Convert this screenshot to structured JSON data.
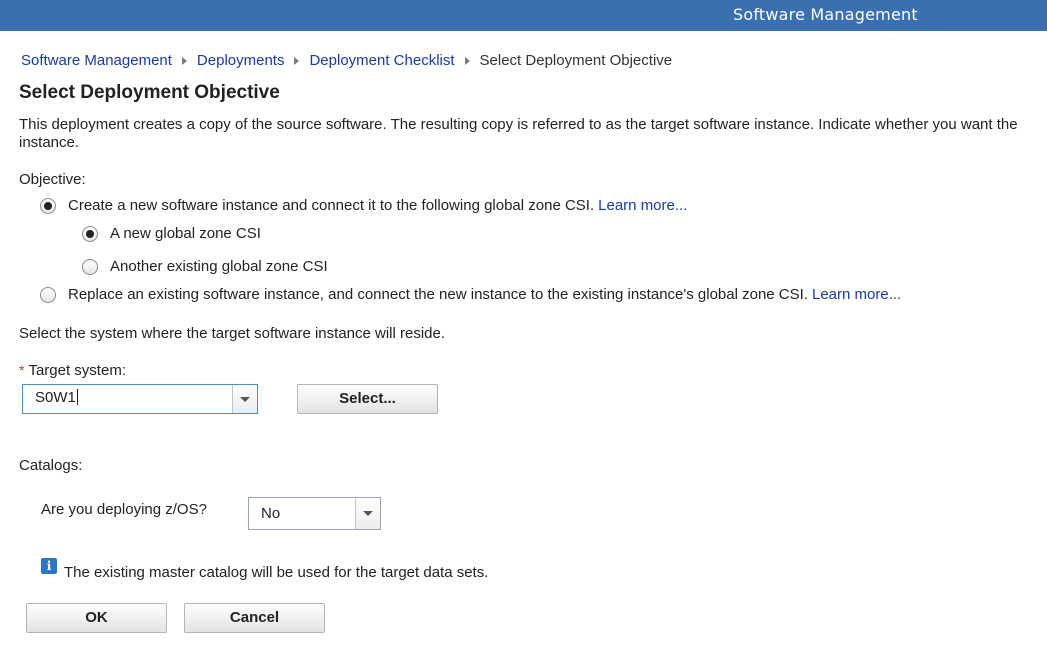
{
  "header": {
    "title": "Software Management"
  },
  "breadcrumb": {
    "items": [
      "Software Management",
      "Deployments",
      "Deployment Checklist"
    ],
    "current": "Select Deployment Objective"
  },
  "page": {
    "title": "Select Deployment Objective",
    "intro_line1": "This deployment creates a copy of the source software. The resulting copy is referred to as the target software instance. Indicate whether you want the",
    "intro_line2": "instance."
  },
  "objective": {
    "label": "Objective:",
    "option_create": "Create a new software instance and connect it to the following global zone CSI.",
    "option_create_link": "Learn more...",
    "sub_new": "A new global zone CSI",
    "sub_existing": "Another existing global zone CSI",
    "option_replace": "Replace an existing software instance, and connect the new instance to the existing instance's global zone CSI.",
    "option_replace_link": "Learn more...",
    "selected": "create",
    "selected_sub": "new"
  },
  "target": {
    "instruction": "Select the system where the target software instance will reside.",
    "label": "Target system:",
    "required_mark": "*",
    "value": "S0W1",
    "select_button": "Select..."
  },
  "catalogs": {
    "label": "Catalogs:",
    "question": "Are you deploying z/OS?",
    "answer": "No",
    "info": "The existing master catalog will be used for the target data sets.",
    "info_icon": "info-icon"
  },
  "actions": {
    "ok": "OK",
    "cancel": "Cancel"
  },
  "colors": {
    "header_bg": "#3a6fb0",
    "link": "#1a3aa3"
  }
}
